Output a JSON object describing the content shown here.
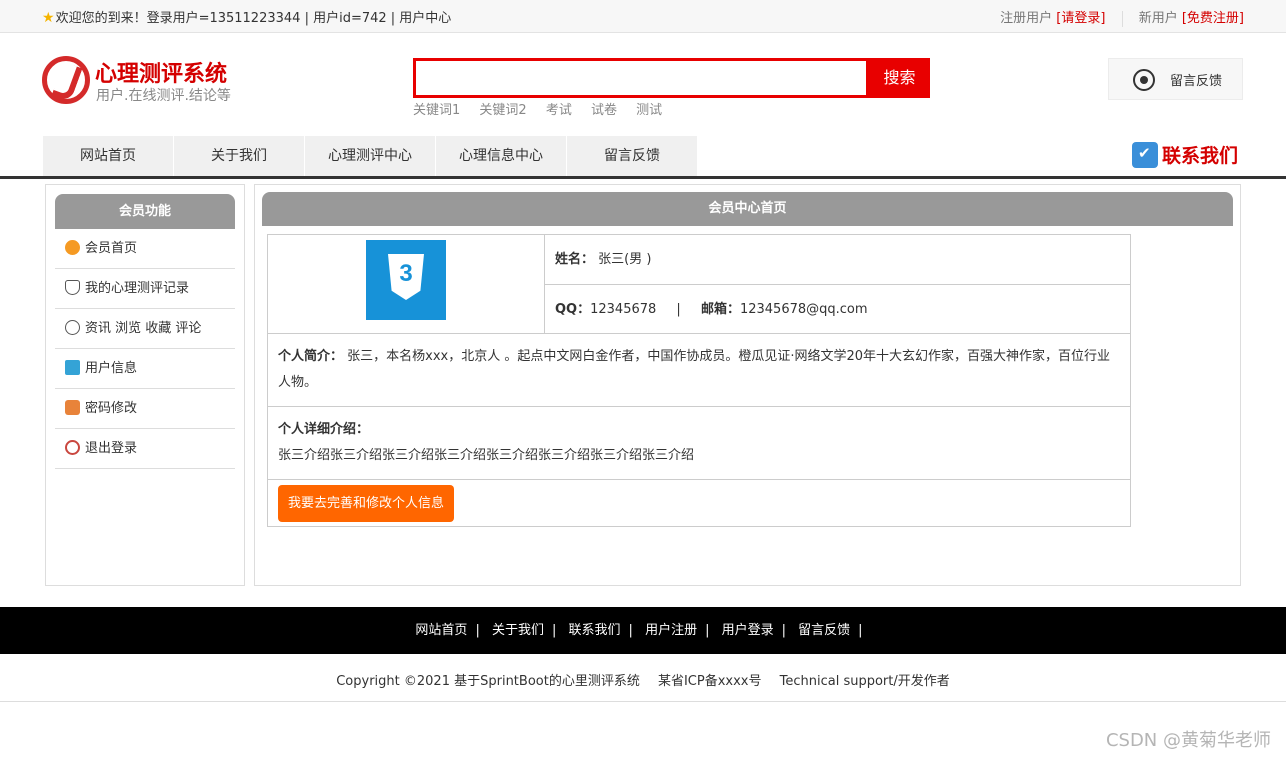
{
  "topbar": {
    "welcome": "欢迎您的到来！登录用户=13511223344 | 用户id=742 | 用户中心",
    "register_user": "注册用户",
    "please_login": "[请登录]",
    "new_user": "新用户",
    "free_register": "[免费注册]"
  },
  "header": {
    "site_title": "心理测评系统",
    "site_subtitle": "用户.在线测评.结论等",
    "search_placeholder": "",
    "search_button": "搜索",
    "keywords": [
      "关键词1",
      "关键词2",
      "考试",
      "试卷",
      "测试"
    ],
    "feedback_label": "留言反馈",
    "contact_label": "联系我们"
  },
  "nav": [
    "网站首页",
    "关于我们",
    "心理测评中心",
    "心理信息中心",
    "留言反馈"
  ],
  "sidebar": {
    "title": "会员功能",
    "items": [
      {
        "label": "会员首页",
        "icon": "home-icon"
      },
      {
        "label": "我的心理测评记录",
        "icon": "record-icon"
      },
      {
        "label": "资讯 浏览 收藏 评论",
        "icon": "clock-icon"
      },
      {
        "label": "用户信息",
        "icon": "user-info-icon"
      },
      {
        "label": "密码修改",
        "icon": "lock-icon"
      },
      {
        "label": "退出登录",
        "icon": "power-icon"
      }
    ]
  },
  "main": {
    "title": "会员中心首页",
    "name_label": "姓名：",
    "name_value": "张三(男 )",
    "qq_label": "QQ：",
    "qq_value": "12345678",
    "divider": "|",
    "email_label": "邮箱：",
    "email_value": "12345678@qq.com",
    "intro_label": "个人简介：",
    "intro_value": "张三，本名杨xxx，北京人 。起点中文网白金作者，中国作协成员。橙瓜见证·网络文学20年十大玄幻作家，百强大神作家，百位行业人物。",
    "detail_label": "个人详细介绍：",
    "detail_value": "张三介绍张三介绍张三介绍张三介绍张三介绍张三介绍张三介绍张三介绍",
    "edit_button": "我要去完善和修改个人信息",
    "avatar_glyph": "3"
  },
  "footer": {
    "links": [
      "网站首页",
      "关于我们",
      "联系我们",
      "用户注册",
      "用户登录",
      "留言反馈"
    ],
    "pipe": "|",
    "copyright": "Copyright ©2021 基于SprintBoot的心里测评系统",
    "icp": "某省ICP备xxxx号",
    "support": "Technical support/开发作者"
  },
  "watermark": "CSDN @黄菊华老师",
  "colors": {
    "brand_red": "#d40000",
    "search_red": "#e80000",
    "button_orange": "#ff6600",
    "header_gray": "#999999"
  }
}
